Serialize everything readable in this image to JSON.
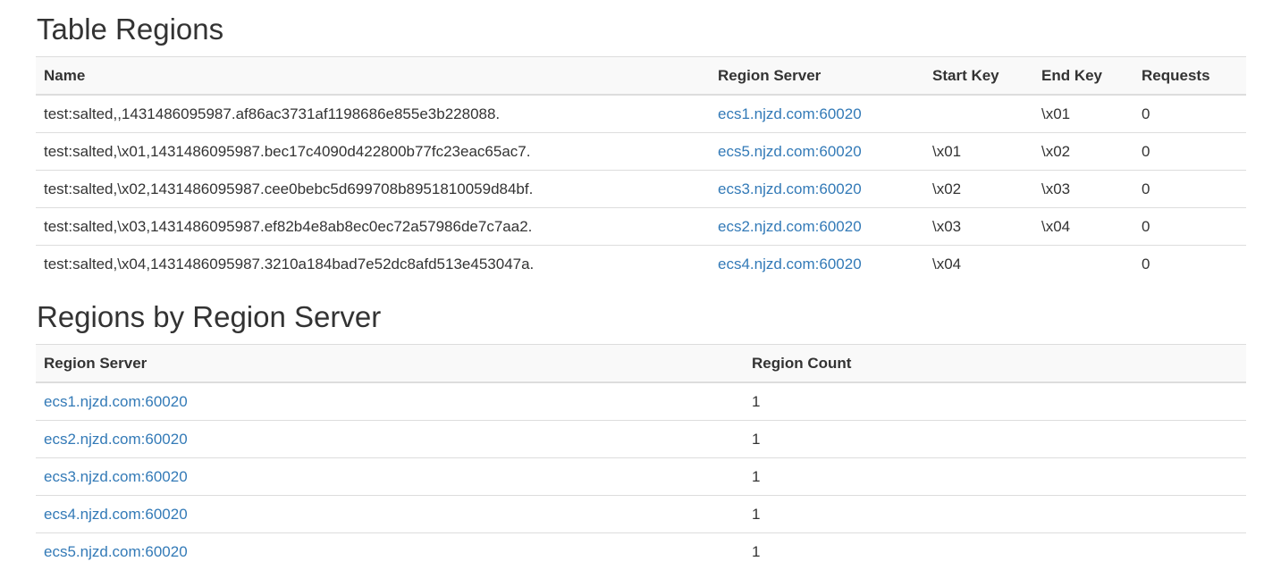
{
  "table_regions": {
    "title": "Table Regions",
    "columns": [
      "Name",
      "Region Server",
      "Start Key",
      "End Key",
      "Requests"
    ],
    "rows": [
      {
        "name": "test:salted,,1431486095987.af86ac3731af1198686e855e3b228088.",
        "server": "ecs1.njzd.com:60020",
        "start_key": "",
        "end_key": "\\x01",
        "requests": "0"
      },
      {
        "name": "test:salted,\\x01,1431486095987.bec17c4090d422800b77fc23eac65ac7.",
        "server": "ecs5.njzd.com:60020",
        "start_key": "\\x01",
        "end_key": "\\x02",
        "requests": "0"
      },
      {
        "name": "test:salted,\\x02,1431486095987.cee0bebc5d699708b8951810059d84bf.",
        "server": "ecs3.njzd.com:60020",
        "start_key": "\\x02",
        "end_key": "\\x03",
        "requests": "0"
      },
      {
        "name": "test:salted,\\x03,1431486095987.ef82b4e8ab8ec0ec72a57986de7c7aa2.",
        "server": "ecs2.njzd.com:60020",
        "start_key": "\\x03",
        "end_key": "\\x04",
        "requests": "0"
      },
      {
        "name": "test:salted,\\x04,1431486095987.3210a184bad7e52dc8afd513e453047a.",
        "server": "ecs4.njzd.com:60020",
        "start_key": "\\x04",
        "end_key": "",
        "requests": "0"
      }
    ]
  },
  "regions_by_server": {
    "title": "Regions by Region Server",
    "columns": [
      "Region Server",
      "Region Count"
    ],
    "rows": [
      {
        "server": "ecs1.njzd.com:60020",
        "count": "1"
      },
      {
        "server": "ecs2.njzd.com:60020",
        "count": "1"
      },
      {
        "server": "ecs3.njzd.com:60020",
        "count": "1"
      },
      {
        "server": "ecs4.njzd.com:60020",
        "count": "1"
      },
      {
        "server": "ecs5.njzd.com:60020",
        "count": "1"
      }
    ]
  },
  "colors": {
    "link": "#337ab7",
    "text": "#333333",
    "border": "#dddddd",
    "header_bg": "#f9f9f9"
  }
}
